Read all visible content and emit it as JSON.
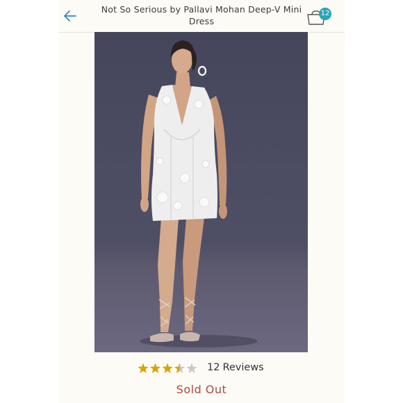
{
  "header": {
    "back_icon": "arrow-left-icon",
    "title": "Not So Serious by Pallavi Mohan Deep-V Mini Dress",
    "bag_icon": "shopping-bag-icon",
    "bag_count": "12",
    "accent_color": "#27a6b5"
  },
  "product": {
    "image_alt": "Model wearing a white sleeveless deep-V mini dress with floral embroidery and lace-up sandals",
    "rating": 3.5,
    "rating_max": 5,
    "star_color": "#d9a400",
    "review_count": "12",
    "review_label": "Reviews",
    "status": "Sold Out",
    "status_color": "#b04a3a"
  }
}
